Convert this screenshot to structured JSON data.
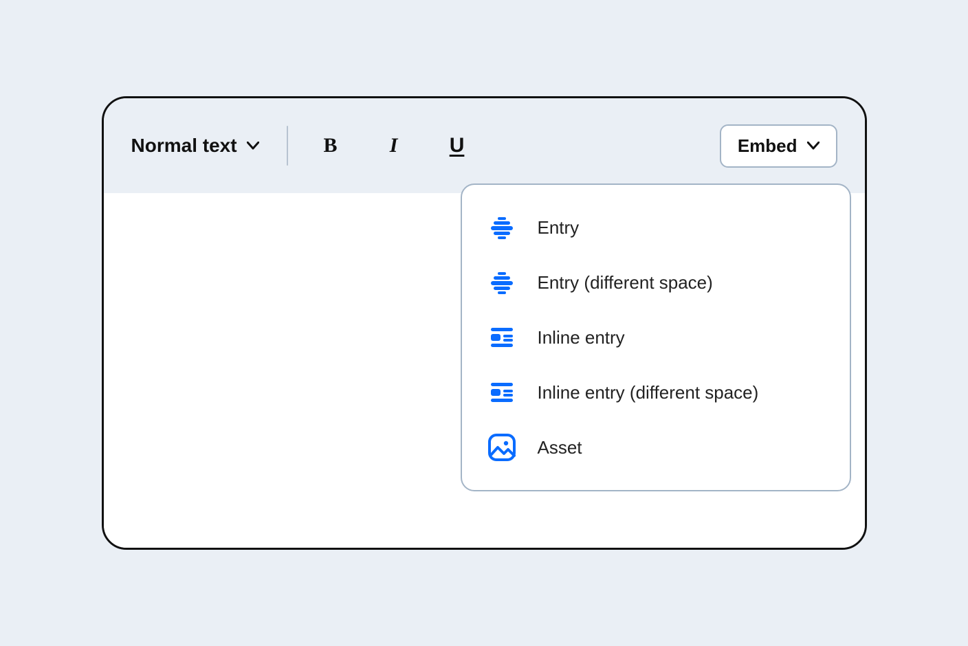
{
  "toolbar": {
    "text_style_label": "Normal text",
    "embed_label": "Embed"
  },
  "embed_menu": {
    "items": [
      {
        "label": "Entry",
        "icon": "entry-block"
      },
      {
        "label": "Entry (different space)",
        "icon": "entry-block"
      },
      {
        "label": "Inline entry",
        "icon": "inline-entry"
      },
      {
        "label": "Inline entry (different space)",
        "icon": "inline-entry"
      },
      {
        "label": "Asset",
        "icon": "asset"
      }
    ]
  }
}
